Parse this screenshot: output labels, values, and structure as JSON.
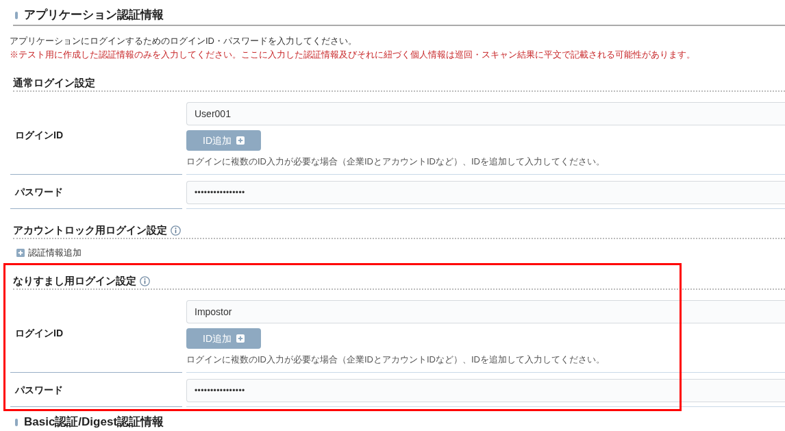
{
  "sections": [
    {
      "title": "アプリケーション認証情報",
      "description": "アプリケーションにログインするためのログインID・パスワードを入力してください。",
      "warning": "※テスト用に作成した認証情報のみを入力してください。ここに入力した認証情報及びそれに紐づく個人情報は巡回・スキャン結果に平文で記載される可能性があります。",
      "groups": [
        {
          "kind": "fields",
          "title": "通常ログイン設定",
          "info": false,
          "highlighted": false,
          "fields": [
            {
              "kind": "text",
              "label": "ログインID",
              "value": "User001",
              "add_button": "ID追加",
              "help": "ログインに複数のID入力が必要な場合（企業IDとアカウントIDなど）、IDを追加して入力してください。"
            },
            {
              "kind": "password",
              "label": "パスワード",
              "value": "••••••••••••••••"
            }
          ]
        },
        {
          "kind": "add_link",
          "title": "アカウントロック用ログイン設定",
          "info": true,
          "highlighted": false,
          "add_link": "認証情報追加"
        },
        {
          "kind": "fields",
          "title": "なりすまし用ログイン設定",
          "info": true,
          "highlighted": true,
          "fields": [
            {
              "kind": "text",
              "label": "ログインID",
              "value": "Impostor",
              "add_button": "ID追加",
              "help": "ログインに複数のID入力が必要な場合（企業IDとアカウントIDなど）、IDを追加して入力してください。"
            },
            {
              "kind": "password",
              "label": "パスワード",
              "value": "••••••••••••••••"
            }
          ]
        }
      ]
    },
    {
      "title": "Basic認証/Digest認証情報"
    }
  ]
}
